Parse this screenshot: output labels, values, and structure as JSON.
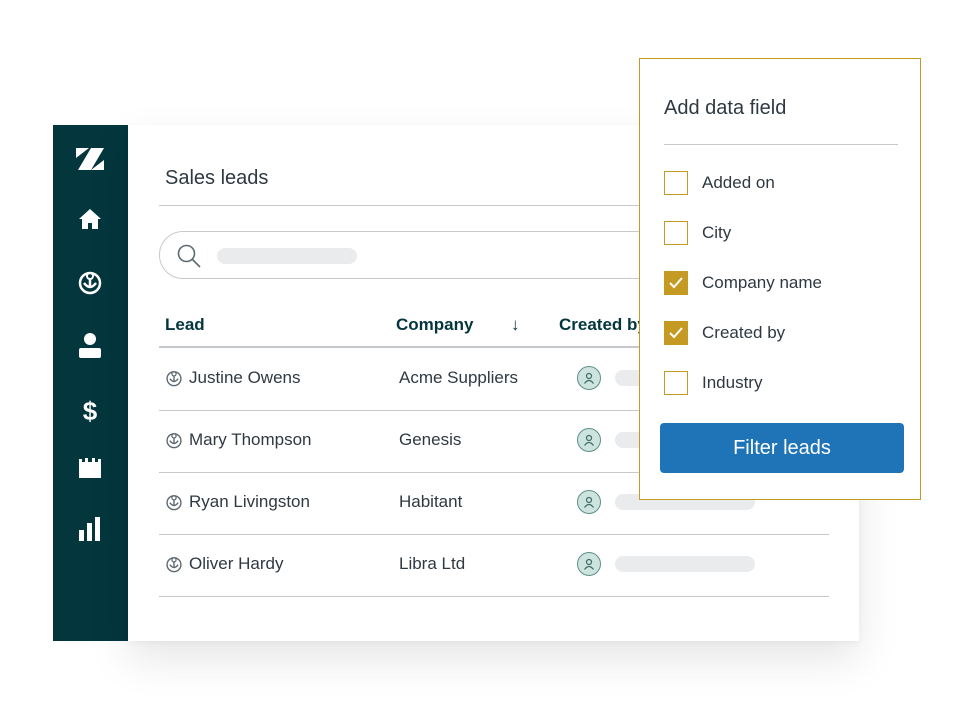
{
  "brand": {
    "icon": "zendesk-logo-icon"
  },
  "sidebar": {
    "items": [
      {
        "icon": "home-icon"
      },
      {
        "icon": "leads-icon"
      },
      {
        "icon": "contact-icon"
      },
      {
        "icon": "deals-icon"
      },
      {
        "icon": "calendar-icon"
      },
      {
        "icon": "reports-icon"
      }
    ]
  },
  "main": {
    "title": "Sales leads",
    "search": {
      "icon": "search-icon"
    },
    "columns": {
      "lead": "Lead",
      "company": "Company",
      "sort_indicator": "↓",
      "created_by": "Created by"
    },
    "rows": [
      {
        "lead": "Justine Owens",
        "company": "Acme Suppliers"
      },
      {
        "lead": "Mary Thompson",
        "company": "Genesis"
      },
      {
        "lead": "Ryan Livingston",
        "company": "Habitant"
      },
      {
        "lead": "Oliver Hardy",
        "company": "Libra Ltd"
      }
    ]
  },
  "panel": {
    "title": "Add data field",
    "options": [
      {
        "label": "Added on",
        "checked": false
      },
      {
        "label": "City",
        "checked": false
      },
      {
        "label": "Company name",
        "checked": true
      },
      {
        "label": "Created by",
        "checked": true
      },
      {
        "label": "Industry",
        "checked": false
      }
    ],
    "button_label": "Filter leads"
  },
  "colors": {
    "sidebar": "#03363d",
    "accent": "#c49a22",
    "button": "#1f73b7",
    "avatar_bg": "#cde3de"
  }
}
